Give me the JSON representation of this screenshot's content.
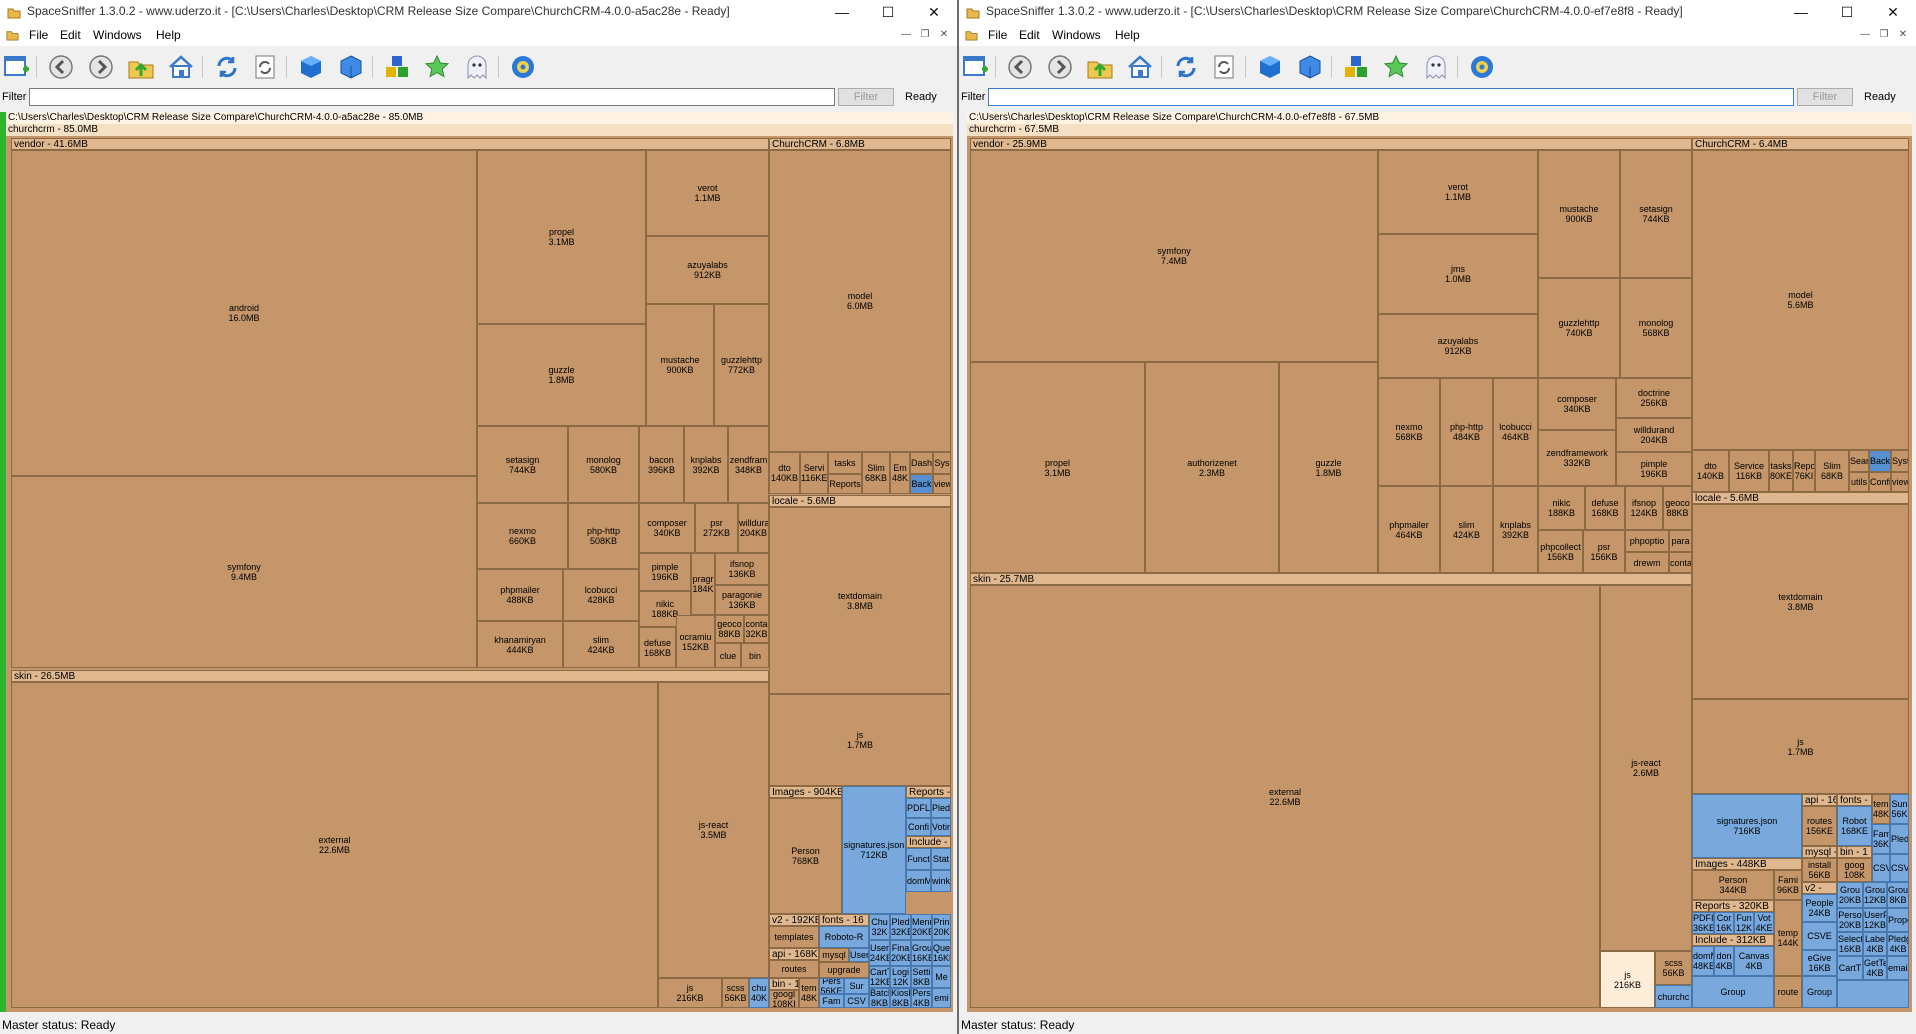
{
  "windows": [
    {
      "title": "SpaceSniffer 1.3.0.2 - www.uderzo.it - [C:\\Users\\Charles\\Desktop\\CRM Release Size Compare\\ChurchCRM-4.0.0-a5ac28e - Ready]",
      "menu": [
        "File",
        "Edit",
        "Windows",
        "Help"
      ],
      "filter": {
        "label": "Filter",
        "value": "",
        "button": "Filter",
        "state": "Ready"
      },
      "path": "C:\\Users\\Charles\\Desktop\\CRM Release Size Compare\\ChurchCRM-4.0.0-a5ac28e - 85.0MB",
      "root": "churchcrm - 85.0MB",
      "status": "Master status: Ready",
      "tiles": {
        "vendor": "vendor - 41.6MB",
        "android": "android\n16.0MB",
        "symfony": "symfony\n9.4MB",
        "propel": "propel\n3.1MB",
        "guzzle": "guzzle\n1.8MB",
        "verot": "verot\n1.1MB",
        "azuyalabs": "azuyalabs\n912KB",
        "mustache": "mustache\n900KB",
        "guzzlehttp": "guzzlehttp\n772KB",
        "setasign": "setasign\n744KB",
        "monolog": "monolog\n580KB",
        "bacon": "bacon\n396KB",
        "knplabs": "knplabs\n392KB",
        "zendfram": "zendfram\n348KB",
        "nexmo": "nexmo\n660KB",
        "phphttp": "php-http\n508KB",
        "composer": "composer\n340KB",
        "psr": "psr\n272KB",
        "willdurand": "willdura\n204KB",
        "phpmailer": "phpmailer\n488KB",
        "lcobucci": "lcobucci\n428KB",
        "pimple": "pimple\n196KB",
        "pragm": "pragr\n184K",
        "ifsnop": "ifsnop\n136KB",
        "paragonie": "paragonie\n136KB",
        "nikic": "nikic\n188KB",
        "geoco": "geoco\n88KB",
        "conta": "conta\n32KB",
        "khanamiryan": "khanamiryan\n444KB",
        "slim": "slim\n424KB",
        "defuse": "defuse\n168KB",
        "ocramius": "ocramiu\n152KB",
        "clue": "clue",
        "bin": "bin",
        "skin": "skin - 26.5MB",
        "external": "external\n22.6MB",
        "jsreact": "js-react\n3.5MB",
        "js": "js\n216KB",
        "scss": "scss\n56KB",
        "chu": "chu\n40K",
        "churchcrm": "ChurchCRM - 6.8MB",
        "model": "model\n6.0MB",
        "dto": "dto\n140KB",
        "servi": "Servi\n116KE",
        "tasks": "tasks",
        "reports": "Reports",
        "slim2": "Slim\n68KB",
        "em": "Em\n48K",
        "dash": "Dash",
        "back": "Back",
        "sys": "Sys",
        "view": "view",
        "locale": "locale - 5.6MB",
        "textdomain": "textdomain\n3.8MB",
        "js2": "js\n1.7MB",
        "images": "Images - 904KB",
        "person": "Person\n768KB",
        "signatures": "signatures.json\n712KB",
        "reports2": "Reports - 32",
        "v2": "v2 - 192KB",
        "templates": "templates",
        "api": "api - 168KB",
        "routes": "routes",
        "bin2": "bin - 1:",
        "googl": "googl\n108KI",
        "fonts": "fonts - 16",
        "roboto": "Roboto-R",
        "mysql": "mysql",
        "upgrade": "upgrade",
        "include": "Include - 31"
      }
    },
    {
      "title": "SpaceSniffer 1.3.0.2 - www.uderzo.it - [C:\\Users\\Charles\\Desktop\\CRM Release Size Compare\\ChurchCRM-4.0.0-ef7e8f8 - Ready]",
      "menu": [
        "File",
        "Edit",
        "Windows",
        "Help"
      ],
      "filter": {
        "label": "Filter",
        "value": "",
        "button": "Filter",
        "state": "Ready"
      },
      "path": "C:\\Users\\Charles\\Desktop\\CRM Release Size Compare\\ChurchCRM-4.0.0-ef7e8f8 - 67.5MB",
      "root": "churchcrm - 67.5MB",
      "status": "Master status: Ready",
      "tiles": {
        "vendor": "vendor - 25.9MB",
        "symfony": "symfony\n7.4MB",
        "propel": "propel\n3.1MB",
        "authorizenet": "authorizenet\n2.3MB",
        "guzzle": "guzzle\n1.8MB",
        "verot": "verot\n1.1MB",
        "jms": "jms\n1.0MB",
        "azuyalabs": "azuyalabs\n912KB",
        "mustache": "mustache\n900KB",
        "setasign": "setasign\n744KB",
        "guzzlehttp": "guzzlehttp\n740KB",
        "monolog": "monolog\n568KB",
        "nexmo": "nexmo\n568KB",
        "phphttp": "php-http\n484KB",
        "lcobucci": "lcobucci\n464KB",
        "composer": "composer\n340KB",
        "doctrine": "doctrine\n256KB",
        "willdurand": "willdurand\n204KB",
        "zendframework": "zendframework\n332KB",
        "pimple": "pimple\n196KB",
        "phpmailer": "phpmailer\n464KB",
        "slim": "slim\n424KB",
        "knplabs": "knplabs\n392KB",
        "nikic": "nikic\n188KB",
        "defuse": "defuse\n168KB",
        "ifsnop": "ifsnop\n124KB",
        "geoco": "geoco\n88KB",
        "phpcollect": "phpcollect\n156KB",
        "psr": "psr\n156KB",
        "phpoption": "phpoptio",
        "drewm": "drewm",
        "para": "para",
        "conta": "conta",
        "skin": "skin - 25.7MB",
        "external": "external\n22.6MB",
        "jsreact": "js-react\n2.6MB",
        "js": "js\n216KB",
        "scss": "scss\n56KB",
        "churchc": "churchc",
        "churchcrm": "ChurchCRM - 6.4MB",
        "model": "model\n5.6MB",
        "dto": "dto\n140KB",
        "service": "Service\n116KB",
        "tasks": "tasks\n80KE",
        "repo": "Repo\n76KI",
        "slim2": "Slim\n68KB",
        "sear": "Sear",
        "backu": "Backu",
        "syst": "Syst",
        "utils": "utils",
        "confi": "Confi",
        "view": "view",
        "locale": "locale - 5.6MB",
        "textdomain": "textdomain\n3.8MB",
        "js2": "js\n1.7MB",
        "signatures": "signatures.json\n716KB",
        "images": "Images - 448KB",
        "person": "Person\n344KB",
        "fami": "Fami\n96KB",
        "reports": "Reports - 320KB",
        "include": "Include - 312KB",
        "api": "api - 16",
        "routes": "routes\n156KE",
        "roboto": "Robot\n168KE",
        "fonts": "fonts -",
        "mysql": "mysql - 1",
        "install": "install\n56KB",
        "googl": "goog\n108K",
        "bin": "bin - 1",
        "v2": "v2 -",
        "temp": "temp\n144K",
        "people": "People\n24KB",
        "csve": "CSVE",
        "egive": "eGive\n16KB",
        "group": "Group"
      }
    }
  ],
  "icons": [
    "new-window-icon",
    "back-icon",
    "forward-icon",
    "up-folder-icon",
    "home-icon",
    "refresh-icon",
    "rescan-icon",
    "blue-cube-icon",
    "blue-cube-outline-icon",
    "colored-cubes-icon",
    "star-icon",
    "ghost-icon",
    "settings-gear-icon"
  ]
}
